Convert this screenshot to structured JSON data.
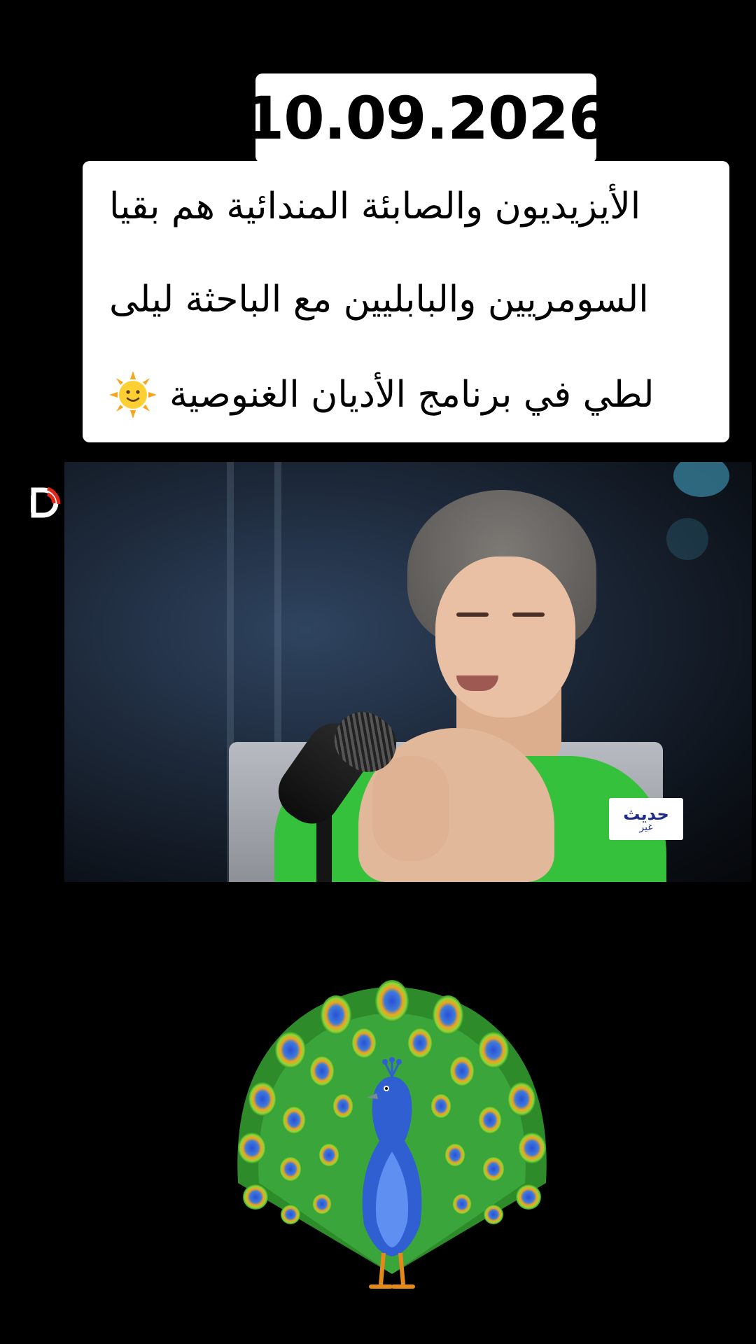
{
  "overlay": {
    "date": "10.09.2026",
    "caption_lines": [
      "الأيزيديون والصابئة المندائية هم بقيا",
      "السومريين والبابليين مع الباحثة ليلى",
      "لطي في برنامج الأديان الغنوصية"
    ],
    "caption_emoji": "sun-with-face-icon",
    "bottom_emoji": "peacock-icon"
  },
  "video": {
    "channel_logo": {
      "line1": "حديث",
      "line2": "غير"
    },
    "watermark": "channel-watermark-icon"
  },
  "colors": {
    "background": "#000000",
    "caption_bg": "#ffffff",
    "dress_green": "#35c13c",
    "logo_blue": "#1f2c8a"
  }
}
